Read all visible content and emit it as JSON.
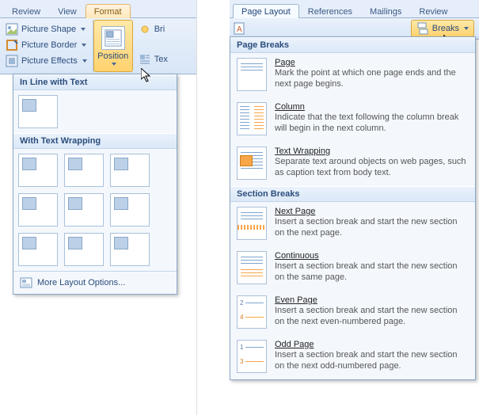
{
  "left": {
    "tabs": [
      "Review",
      "View",
      "Format"
    ],
    "active_tab": 2,
    "picture_shape": "Picture Shape",
    "picture_border": "Picture Border",
    "picture_effects": "Picture Effects",
    "position_label": "Position",
    "brightness_crumb": "Bri",
    "text_crumb": "Tex",
    "menu": {
      "section_inline": "In Line with Text",
      "section_wrap": "With Text Wrapping",
      "more_layout": "More Layout Options..."
    }
  },
  "right": {
    "tabs": [
      "Page Layout",
      "References",
      "Mailings",
      "Review"
    ],
    "active_tab": 0,
    "breaks_label": "Breaks",
    "menu": {
      "page_breaks_header": "Page Breaks",
      "section_breaks_header": "Section Breaks",
      "items": [
        {
          "title": "Page",
          "desc": "Mark the point at which one page ends and the next page begins."
        },
        {
          "title": "Column",
          "desc": "Indicate that the text following the column break will begin in the next column."
        },
        {
          "title": "Text Wrapping",
          "desc": "Separate text around objects on web pages, such as caption text from body text."
        }
      ],
      "section_items": [
        {
          "title": "Next Page",
          "desc": "Insert a section break and start the new section on the next page."
        },
        {
          "title": "Continuous",
          "desc": "Insert a section break and start the new section on the same page."
        },
        {
          "title": "Even Page",
          "desc": "Insert a section break and start the new section on the next even-numbered page."
        },
        {
          "title": "Odd Page",
          "desc": "Insert a section break and start the new section on the next odd-numbered page."
        }
      ]
    }
  }
}
